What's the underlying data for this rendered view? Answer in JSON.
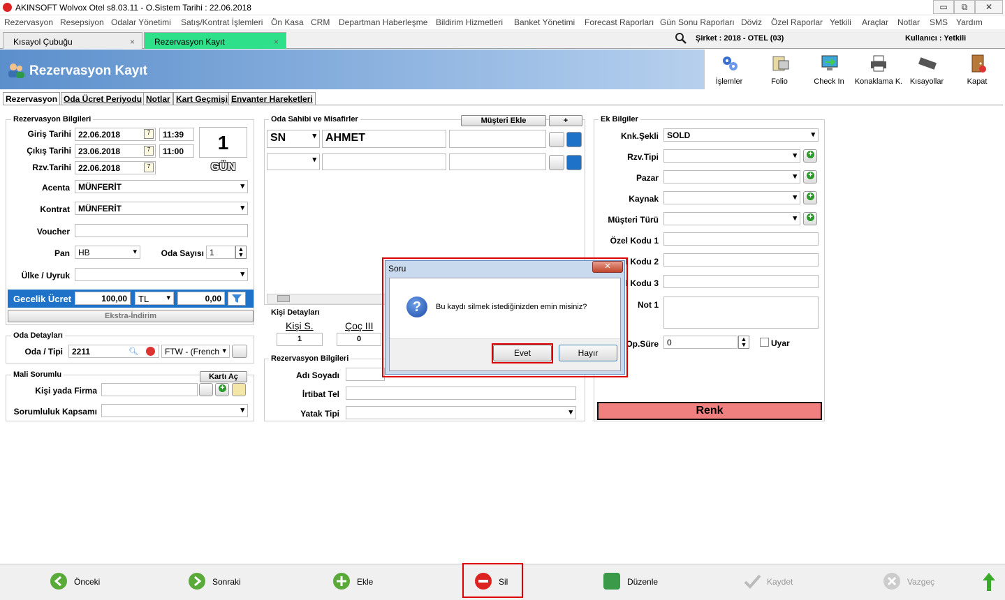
{
  "window": {
    "title": "AKINSOFT Wolvox Otel s8.03.11 - O.Sistem Tarihi : 22.06.2018",
    "minimize": "▭",
    "restore": "⧉",
    "close": "✕"
  },
  "menu": [
    "Rezervasyon",
    "Resepsiyon",
    "Odalar Yönetimi",
    "Satış/Kontrat İşlemleri",
    "Ön Kasa",
    "CRM",
    "Departman Haberleşme",
    "Bildirim Hizmetleri",
    "Banket Yönetimi",
    "Forecast Raporları",
    "Gün Sonu Raporları",
    "Döviz",
    "Özel Raporlar",
    "Yetkili",
    "Araçlar",
    "Notlar",
    "SMS",
    "Yardım"
  ],
  "doc_tabs": {
    "tab1": "Kısayol Çubuğu",
    "tab2": "Rezervasyon Kayıt",
    "close": "×"
  },
  "company": "Şirket : 2018 - OTEL (03)",
  "user": "Kullanıcı : Yetkili",
  "header": {
    "title": "Rezervasyon Kayıt"
  },
  "toolbar": {
    "islemler": "İşlemler",
    "folio": "Folio",
    "checkin": "Check In",
    "konaklama": "Konaklama K.",
    "kisayollar": "Kısayollar",
    "kapat": "Kapat"
  },
  "subtabs": [
    "Rezervasyon",
    "Oda Ücret Periyodu",
    "Notlar",
    "Kart Geçmişi",
    "Envanter Hareketleri"
  ],
  "rez_bilgileri": {
    "title": "Rezervasyon Bilgileri",
    "giris_label": "Giriş Tarihi",
    "giris": "22.06.2018",
    "giris_time": "11:39",
    "cikis_label": "Çıkış Tarihi",
    "cikis": "23.06.2018",
    "cikis_time": "11:00",
    "rzv_label": "Rzv.Tarihi",
    "rzv": "22.06.2018",
    "days": "1",
    "days_unit": "GÜN",
    "acenta_label": "Acenta",
    "acenta": "MÜNFERİT",
    "kontrat_label": "Kontrat",
    "kontrat": "MÜNFERİT",
    "voucher_label": "Voucher",
    "voucher": "",
    "pan_label": "Pan",
    "pan": "HB",
    "oda_sayisi_label": "Oda Sayısı",
    "oda_sayisi": "1",
    "ulke_label": "Ülke / Uyruk",
    "ulke": "",
    "gecelik_label": "Gecelik Ücret",
    "gecelik": "100,00",
    "currency": "TL",
    "gecelik2": "0,00",
    "ekstra": "Ekstra-İndirim"
  },
  "oda_detaylari": {
    "title": "Oda Detayları",
    "oda_label": "Oda / Tipi",
    "oda": "2211",
    "tip": "FTW - (French"
  },
  "mali": {
    "title": "Mali Sorumlu",
    "karti_ac": "Kartı Aç",
    "kisi_label": "Kişi yada Firma",
    "kisi": "",
    "kapsam_label": "Sorumluluk Kapsamı",
    "kapsam": ""
  },
  "oda_sahibi": {
    "title": "Oda Sahibi ve Misafirler",
    "musteri_ekle": "Müşteri Ekle",
    "plus": "+",
    "row1_title": "SN",
    "row1_name": "AHMET",
    "row1_extra": "",
    "row2_title": "",
    "row2_name": "",
    "row2_extra": ""
  },
  "kisi_detaylari": {
    "title": "Kişi Detayları",
    "kisi_s_label": "Kişi S.",
    "cocuk_label": "Çoç III",
    "kisi_s": "1",
    "cocuk": "0"
  },
  "rez_bilgileri2": {
    "title": "Rezervasyon Bilgileri",
    "adi_label": "Adı Soyadı",
    "irtibat_label": "İrtibat Tel",
    "yatak_label": "Yatak Tipi",
    "adi": "",
    "irtibat": "",
    "yatak": ""
  },
  "ek_bilgiler": {
    "title": "Ek Bilgiler",
    "knk_label": "Knk.Şekli",
    "knk": "SOLD",
    "rzv_tipi_label": "Rzv.Tipi",
    "pazar_label": "Pazar",
    "kaynak_label": "Kaynak",
    "musteri_turu_label": "Müşteri Türü",
    "ozel1_label": "Özel Kodu 1",
    "ozel2_label": "l Kodu 2",
    "ozel3_label": "l Kodu 3",
    "not1_label": "Not 1",
    "op_label": "Op.Süre",
    "op": "0",
    "uyar_label": "Uyar",
    "renk": "Renk"
  },
  "dialog": {
    "title": "Soru",
    "message": "Bu kaydı silmek istediğinizden emin misiniz?",
    "yes": "Evet",
    "no": "Hayır",
    "close": "✕",
    "icon": "?"
  },
  "bottom": {
    "onceki": "Önceki",
    "sonraki": "Sonraki",
    "ekle": "Ekle",
    "sil": "Sil",
    "duzenle": "Düzenle",
    "kaydet": "Kaydet",
    "vazgec": "Vazgeç"
  },
  "colors": {
    "header_blue": "#5b8fcc",
    "gecelik_blue": "#1e73c8",
    "renk_pink": "#f08080",
    "highlight_red": "#dd0000",
    "active_tab_green": "#2ee08a"
  }
}
